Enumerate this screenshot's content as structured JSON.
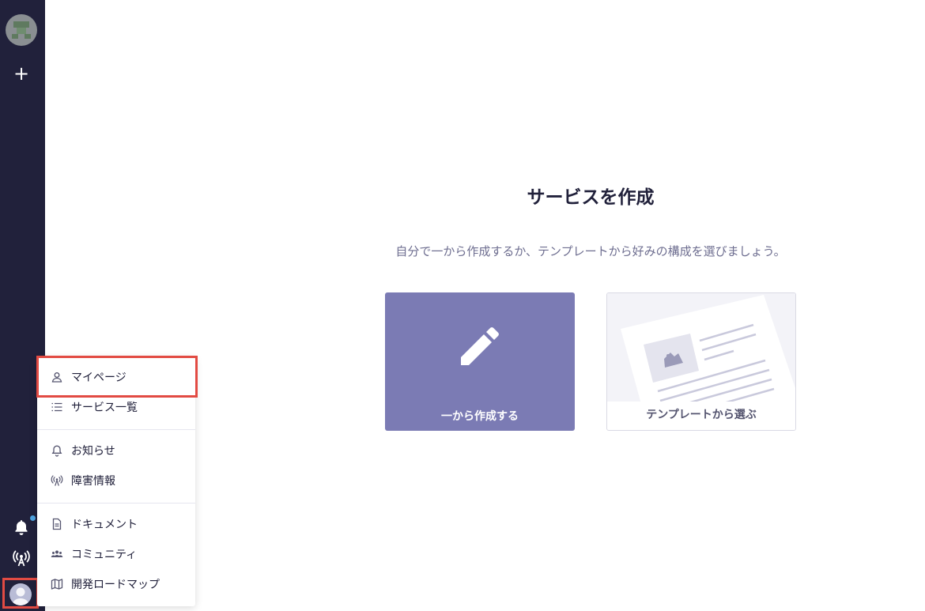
{
  "main": {
    "title": "サービスを作成",
    "subtitle": "自分で一から作成するか、テンプレートから好みの構成を選びましょう。",
    "cards": {
      "scratch": {
        "label": "一から作成する",
        "icon": "pencil-icon",
        "color": "#7b7bb4"
      },
      "template": {
        "label": "テンプレートから選ぶ",
        "icon": "template-illustration"
      }
    }
  },
  "sidebar": {
    "add_label": "+",
    "icons": [
      "service-avatar",
      "plus-icon",
      "bell-icon",
      "antenna-icon",
      "user-avatar"
    ],
    "notification_dot_color": "#4ea3e0"
  },
  "menu": {
    "items": [
      {
        "label": "マイページ",
        "icon": "user-icon"
      },
      {
        "label": "サービス一覧",
        "icon": "list-icon"
      },
      {
        "label": "お知らせ",
        "icon": "bell-icon"
      },
      {
        "label": "障害情報",
        "icon": "antenna-icon"
      },
      {
        "label": "ドキュメント",
        "icon": "document-icon"
      },
      {
        "label": "コミュニティ",
        "icon": "people-icon"
      },
      {
        "label": "開発ロードマップ",
        "icon": "map-icon"
      }
    ]
  },
  "colors": {
    "sidebar_bg": "#21213b",
    "highlight": "#e24b43",
    "accent": "#7b7bb4"
  }
}
